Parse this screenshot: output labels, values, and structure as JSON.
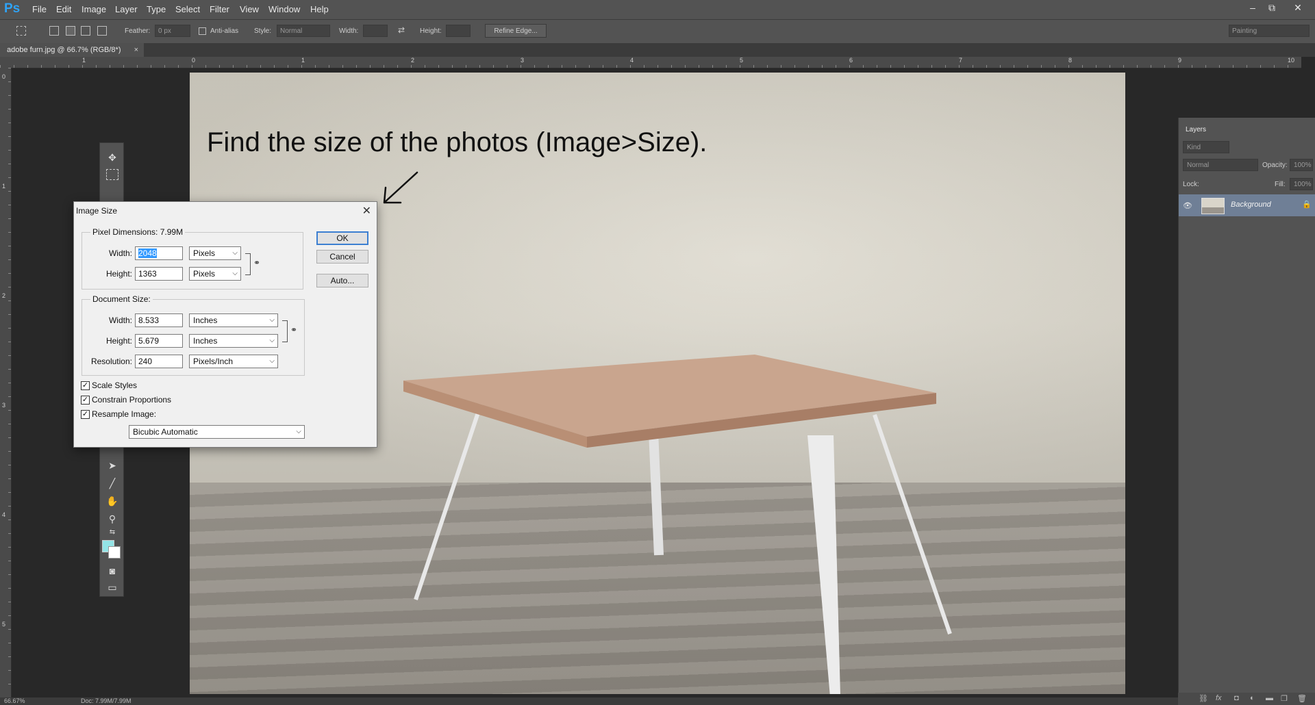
{
  "app": {
    "logo": "Ps",
    "menu": [
      "File",
      "Edit",
      "Image",
      "Layer",
      "Type",
      "Select",
      "Filter",
      "View",
      "Window",
      "Help"
    ],
    "window_controls": [
      "–",
      "⧉",
      "✕"
    ]
  },
  "options_bar": {
    "feather_label": "Feather:",
    "feather_value": "0 px",
    "antialias_label": "Anti-alias",
    "style_label": "Style:",
    "style_value": "Normal",
    "width_label": "Width:",
    "height_label": "Height:",
    "refine_edge": "Refine Edge...",
    "workspace": "Painting"
  },
  "document": {
    "tab_title": "adobe furn.jpg @ 66.7% (RGB/8*)",
    "tab_close": "×",
    "annotation_text": "Find the size of the photos (Image>Size)."
  },
  "rulers": {
    "top": [
      "1",
      "0",
      "1",
      "2",
      "3",
      "4",
      "5",
      "6",
      "7",
      "8",
      "9",
      "10"
    ],
    "left": [
      "0",
      "1",
      "2",
      "3",
      "4",
      "5"
    ]
  },
  "dialog": {
    "title": "Image Size",
    "close": "✕",
    "pixel_dimensions_label": "Pixel Dimensions:",
    "pixel_dimensions_value": "7.99M",
    "px_width_label": "Width:",
    "px_width_value": "2048",
    "px_width_unit": "Pixels",
    "px_height_label": "Height:",
    "px_height_value": "1363",
    "px_height_unit": "Pixels",
    "document_size_label": "Document Size:",
    "doc_width_label": "Width:",
    "doc_width_value": "8.533",
    "doc_width_unit": "Inches",
    "doc_height_label": "Height:",
    "doc_height_value": "5.679",
    "doc_height_unit": "Inches",
    "resolution_label": "Resolution:",
    "resolution_value": "240",
    "resolution_unit": "Pixels/Inch",
    "scale_styles": "Scale Styles",
    "constrain_proportions": "Constrain Proportions",
    "resample_image": "Resample Image:",
    "resample_method": "Bicubic Automatic",
    "ok": "OK",
    "cancel": "Cancel",
    "auto": "Auto...",
    "checked": "✓"
  },
  "layers_panel": {
    "tab": "Layers",
    "kind": "Kind",
    "blend_mode": "Normal",
    "opacity_label": "Opacity:",
    "opacity_value": "100%",
    "lock_label": "Lock:",
    "fill_label": "Fill:",
    "fill_value": "100%",
    "layer_name": "Background"
  },
  "status": {
    "zoom": "66.67%",
    "doc_info": "Doc: 7.99M/7.99M"
  },
  "colors": {
    "foreground": "#93e4e6",
    "background": "#ffffff",
    "accent": "#3c7fd1"
  }
}
